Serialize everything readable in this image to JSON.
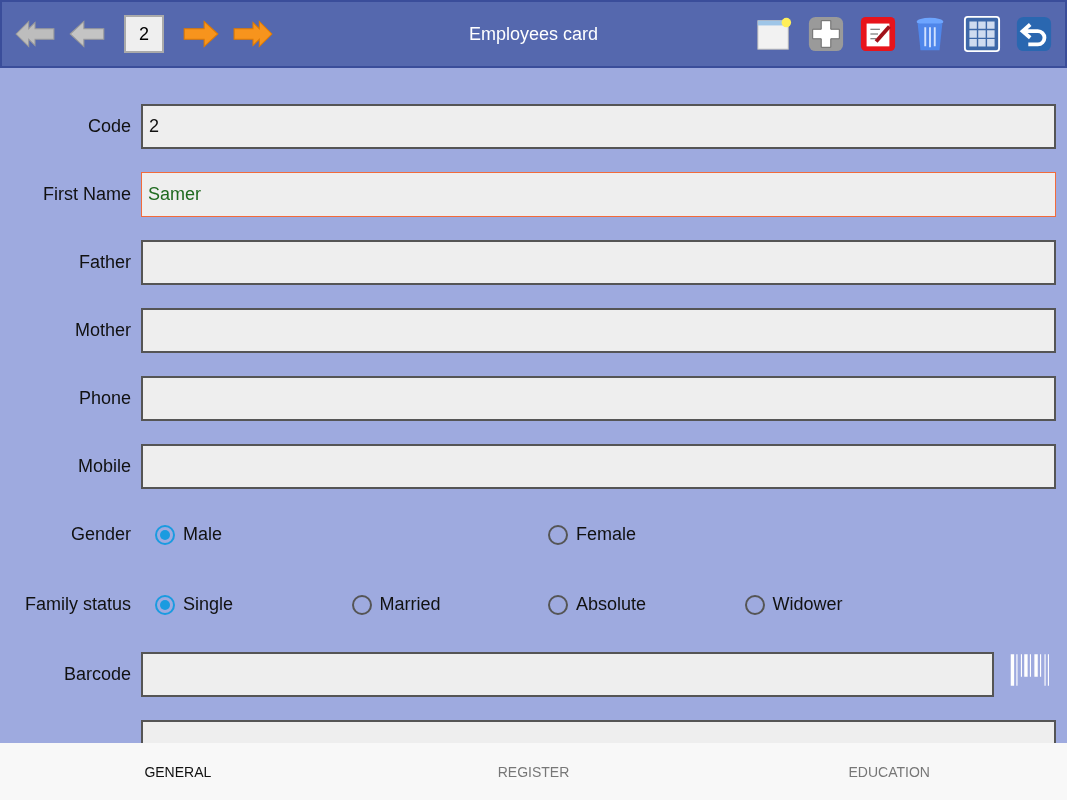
{
  "header": {
    "title": "Employees card",
    "record": "2"
  },
  "fields": [
    {
      "label": "Code",
      "value": "2",
      "focused": false
    },
    {
      "label": "First Name",
      "value": "Samer",
      "focused": true
    },
    {
      "label": "Father",
      "focused": false
    },
    {
      "label": "Mother",
      "focused": false
    },
    {
      "label": "Phone",
      "focused": false
    },
    {
      "label": "Mobile",
      "focused": false
    }
  ],
  "radio_groups": [
    {
      "label": "Gender",
      "options": [
        {
          "label": "Male",
          "selected": true
        },
        {
          "label": "Female",
          "selected": false
        }
      ]
    },
    {
      "label": "Family status",
      "options": [
        {
          "label": "Single",
          "selected": true
        },
        {
          "label": "Married",
          "selected": false
        },
        {
          "label": "Absolute",
          "selected": false
        },
        {
          "label": "Widower",
          "selected": false
        }
      ]
    }
  ],
  "barcode": {
    "label": "Barcode"
  },
  "tabs": [
    {
      "label": "GENERAL",
      "selected": true
    },
    {
      "label": "REGISTER",
      "selected": false
    },
    {
      "label": "EDUCATION",
      "selected": false
    }
  ]
}
